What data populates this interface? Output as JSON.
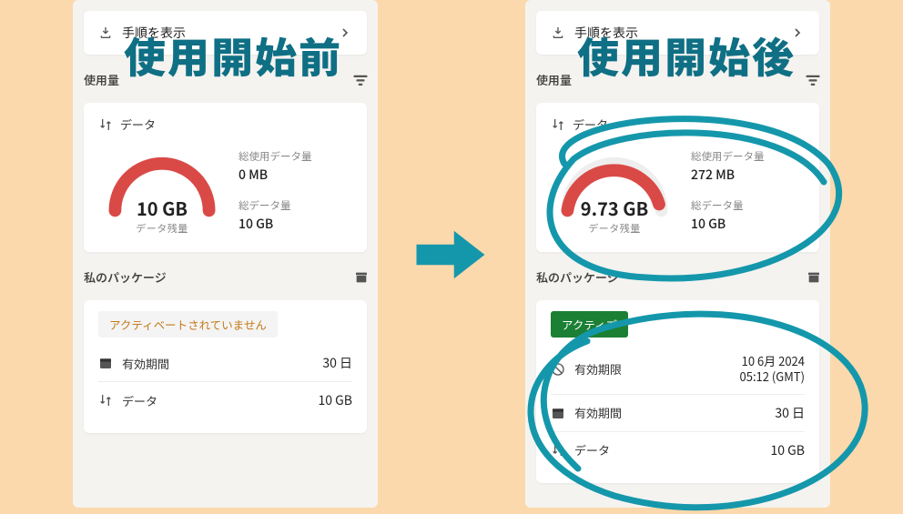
{
  "annotations": {
    "before_title": "使用開始前",
    "after_title": "使用開始後"
  },
  "topbar": {
    "show_steps": "手順を表示"
  },
  "sections": {
    "usage_title": "使用量",
    "data_label": "データ",
    "total_used_label": "総使用データ量",
    "total_data_label": "総データ量",
    "remaining_label": "データ残量",
    "my_package_title": "私のパッケージ"
  },
  "before": {
    "remaining": "10 GB",
    "used": "0 MB",
    "total": "10 GB",
    "pkg_status": "アクティベートされていません",
    "validity_label": "有効期間",
    "validity_value": "30 日",
    "data_label": "データ",
    "data_value": "10 GB"
  },
  "after": {
    "remaining": "9.73 GB",
    "used": "272 MB",
    "total": "10 GB",
    "pkg_status": "アクティブ",
    "expires_label": "有効期限",
    "expires_value_line1": "10 6月 2024",
    "expires_value_line2": "05:12 (GMT)",
    "validity_label": "有効期間",
    "validity_value": "30 日",
    "data_label": "データ",
    "data_value": "10 GB"
  },
  "chart_data": [
    {
      "type": "gauge",
      "title": "データ残量 (before)",
      "value": 10,
      "max": 10,
      "unit": "GB",
      "value_label": "10 GB"
    },
    {
      "type": "gauge",
      "title": "データ残量 (after)",
      "value": 9.73,
      "max": 10,
      "unit": "GB",
      "value_label": "9.73 GB"
    }
  ]
}
